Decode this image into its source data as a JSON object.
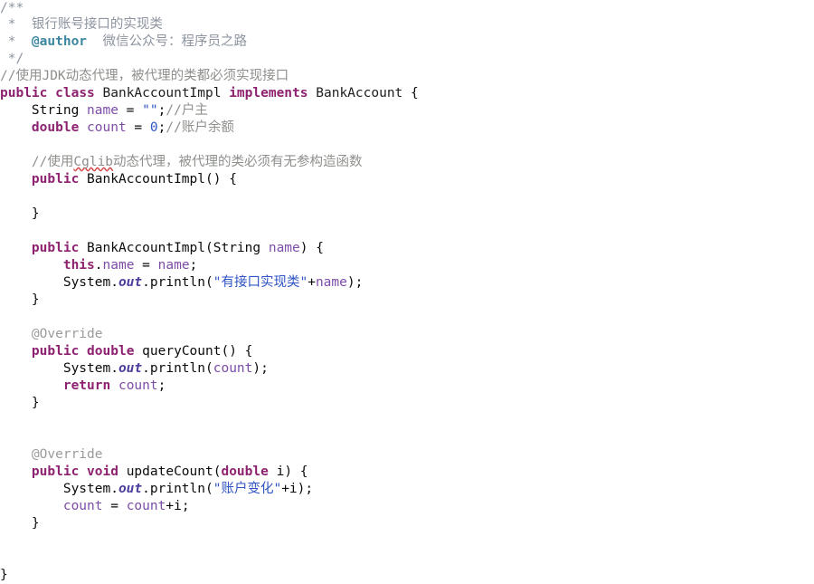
{
  "editor": {
    "language": "java",
    "background_color": "#ffffff",
    "colors": {
      "keyword": "#8e2270",
      "comment": "#8e908c",
      "javadoc": "#8d94a0",
      "javadoc_tag": "#3d86a0",
      "string": "#2f55c4",
      "field": "#7d4ca8",
      "static_member": "#4b3f9e",
      "annotation": "#9b9b9b",
      "plain_text": "#0b0b0b",
      "spellcheck_underline": "#d64545"
    },
    "lines": [
      {
        "indent": 0,
        "tokens": [
          {
            "t": "/**",
            "c": "doc"
          }
        ]
      },
      {
        "indent": 0,
        "tokens": [
          {
            "t": " *  银行账号接口的实现类",
            "c": "doc"
          }
        ]
      },
      {
        "indent": 0,
        "tokens": [
          {
            "t": " *  ",
            "c": "doc"
          },
          {
            "t": "@author",
            "c": "doctag"
          },
          {
            "t": "  微信公众号：程序员之路",
            "c": "doc"
          }
        ]
      },
      {
        "indent": 0,
        "tokens": [
          {
            "t": " */",
            "c": "doc"
          }
        ]
      },
      {
        "indent": 0,
        "tokens": [
          {
            "t": "//使用JDK动态代理，被代理的类都必须实现接口",
            "c": "comment"
          }
        ]
      },
      {
        "indent": 0,
        "tokens": [
          {
            "t": "public",
            "c": "keyword"
          },
          {
            "t": " ",
            "c": "plain"
          },
          {
            "t": "class",
            "c": "keyword"
          },
          {
            "t": " ",
            "c": "plain"
          },
          {
            "t": "BankAccountImpl",
            "c": "classname"
          },
          {
            "t": " ",
            "c": "plain"
          },
          {
            "t": "implements",
            "c": "keyword"
          },
          {
            "t": " ",
            "c": "plain"
          },
          {
            "t": "BankAccount",
            "c": "classname"
          },
          {
            "t": " {",
            "c": "plain"
          }
        ]
      },
      {
        "indent": 0,
        "tokens": [
          {
            "t": "    String ",
            "c": "plain"
          },
          {
            "t": "name",
            "c": "field"
          },
          {
            "t": " = ",
            "c": "plain"
          },
          {
            "t": "\"\"",
            "c": "string"
          },
          {
            "t": ";",
            "c": "plain"
          },
          {
            "t": "//户主",
            "c": "comment"
          }
        ]
      },
      {
        "indent": 0,
        "tokens": [
          {
            "t": "    ",
            "c": "plain"
          },
          {
            "t": "double",
            "c": "keyword"
          },
          {
            "t": " ",
            "c": "plain"
          },
          {
            "t": "count",
            "c": "field"
          },
          {
            "t": " = ",
            "c": "plain"
          },
          {
            "t": "0",
            "c": "number"
          },
          {
            "t": ";",
            "c": "plain"
          },
          {
            "t": "//账户余额",
            "c": "comment"
          }
        ]
      },
      {
        "indent": 0,
        "tokens": []
      },
      {
        "indent": 0,
        "tokens": [
          {
            "t": "    //使用",
            "c": "comment"
          },
          {
            "t": "Cglib",
            "c": "comment",
            "spell": true
          },
          {
            "t": "动态代理，被代理的类必须有无参构造函数",
            "c": "comment"
          }
        ]
      },
      {
        "indent": 0,
        "tokens": [
          {
            "t": "    ",
            "c": "plain"
          },
          {
            "t": "public",
            "c": "keyword"
          },
          {
            "t": " ",
            "c": "plain"
          },
          {
            "t": "BankAccountImpl",
            "c": "plain"
          },
          {
            "t": "() {",
            "c": "plain"
          }
        ]
      },
      {
        "indent": 0,
        "tokens": []
      },
      {
        "indent": 0,
        "tokens": [
          {
            "t": "    }",
            "c": "plain"
          }
        ]
      },
      {
        "indent": 0,
        "tokens": []
      },
      {
        "indent": 0,
        "tokens": [
          {
            "t": "    ",
            "c": "plain"
          },
          {
            "t": "public",
            "c": "keyword"
          },
          {
            "t": " ",
            "c": "plain"
          },
          {
            "t": "BankAccountImpl",
            "c": "plain"
          },
          {
            "t": "(String ",
            "c": "plain"
          },
          {
            "t": "name",
            "c": "param"
          },
          {
            "t": ") {",
            "c": "plain"
          }
        ]
      },
      {
        "indent": 0,
        "tokens": [
          {
            "t": "        ",
            "c": "plain"
          },
          {
            "t": "this",
            "c": "keyword"
          },
          {
            "t": ".",
            "c": "plain"
          },
          {
            "t": "name",
            "c": "field"
          },
          {
            "t": " = ",
            "c": "plain"
          },
          {
            "t": "name",
            "c": "param"
          },
          {
            "t": ";",
            "c": "plain"
          }
        ]
      },
      {
        "indent": 0,
        "tokens": [
          {
            "t": "        System.",
            "c": "plain"
          },
          {
            "t": "out",
            "c": "static"
          },
          {
            "t": ".println(",
            "c": "plain"
          },
          {
            "t": "\"有接口实现类\"",
            "c": "string"
          },
          {
            "t": "+",
            "c": "plain"
          },
          {
            "t": "name",
            "c": "param"
          },
          {
            "t": ");",
            "c": "plain"
          }
        ]
      },
      {
        "indent": 0,
        "tokens": [
          {
            "t": "    }",
            "c": "plain"
          }
        ]
      },
      {
        "indent": 0,
        "tokens": []
      },
      {
        "indent": 0,
        "tokens": [
          {
            "t": "    ",
            "c": "plain"
          },
          {
            "t": "@Override",
            "c": "anno"
          }
        ]
      },
      {
        "indent": 0,
        "tokens": [
          {
            "t": "    ",
            "c": "plain"
          },
          {
            "t": "public",
            "c": "keyword"
          },
          {
            "t": " ",
            "c": "plain"
          },
          {
            "t": "double",
            "c": "keyword"
          },
          {
            "t": " queryCount() {",
            "c": "plain"
          }
        ]
      },
      {
        "indent": 0,
        "tokens": [
          {
            "t": "        System.",
            "c": "plain"
          },
          {
            "t": "out",
            "c": "static"
          },
          {
            "t": ".println(",
            "c": "plain"
          },
          {
            "t": "count",
            "c": "field"
          },
          {
            "t": ");",
            "c": "plain"
          }
        ]
      },
      {
        "indent": 0,
        "tokens": [
          {
            "t": "        ",
            "c": "plain"
          },
          {
            "t": "return",
            "c": "keyword"
          },
          {
            "t": " ",
            "c": "plain"
          },
          {
            "t": "count",
            "c": "field"
          },
          {
            "t": ";",
            "c": "plain"
          }
        ]
      },
      {
        "indent": 0,
        "tokens": [
          {
            "t": "    }",
            "c": "plain"
          }
        ]
      },
      {
        "indent": 0,
        "tokens": []
      },
      {
        "indent": 0,
        "tokens": []
      },
      {
        "indent": 0,
        "tokens": [
          {
            "t": "    ",
            "c": "plain"
          },
          {
            "t": "@Override",
            "c": "anno"
          }
        ]
      },
      {
        "indent": 0,
        "tokens": [
          {
            "t": "    ",
            "c": "plain"
          },
          {
            "t": "public",
            "c": "keyword"
          },
          {
            "t": " ",
            "c": "plain"
          },
          {
            "t": "void",
            "c": "keyword"
          },
          {
            "t": " updateCount(",
            "c": "plain"
          },
          {
            "t": "double",
            "c": "keyword"
          },
          {
            "t": " i) {",
            "c": "plain"
          }
        ]
      },
      {
        "indent": 0,
        "tokens": [
          {
            "t": "        System.",
            "c": "plain"
          },
          {
            "t": "out",
            "c": "static"
          },
          {
            "t": ".println(",
            "c": "plain"
          },
          {
            "t": "\"账户变化\"",
            "c": "string"
          },
          {
            "t": "+i);",
            "c": "plain"
          }
        ]
      },
      {
        "indent": 0,
        "tokens": [
          {
            "t": "        ",
            "c": "plain"
          },
          {
            "t": "count",
            "c": "field"
          },
          {
            "t": " = ",
            "c": "plain"
          },
          {
            "t": "count",
            "c": "field"
          },
          {
            "t": "+i;",
            "c": "plain"
          }
        ]
      },
      {
        "indent": 0,
        "tokens": [
          {
            "t": "    }",
            "c": "plain"
          }
        ]
      },
      {
        "indent": 0,
        "tokens": []
      },
      {
        "indent": 0,
        "tokens": []
      },
      {
        "indent": 0,
        "tokens": [
          {
            "t": "}",
            "c": "plain"
          }
        ]
      }
    ]
  }
}
